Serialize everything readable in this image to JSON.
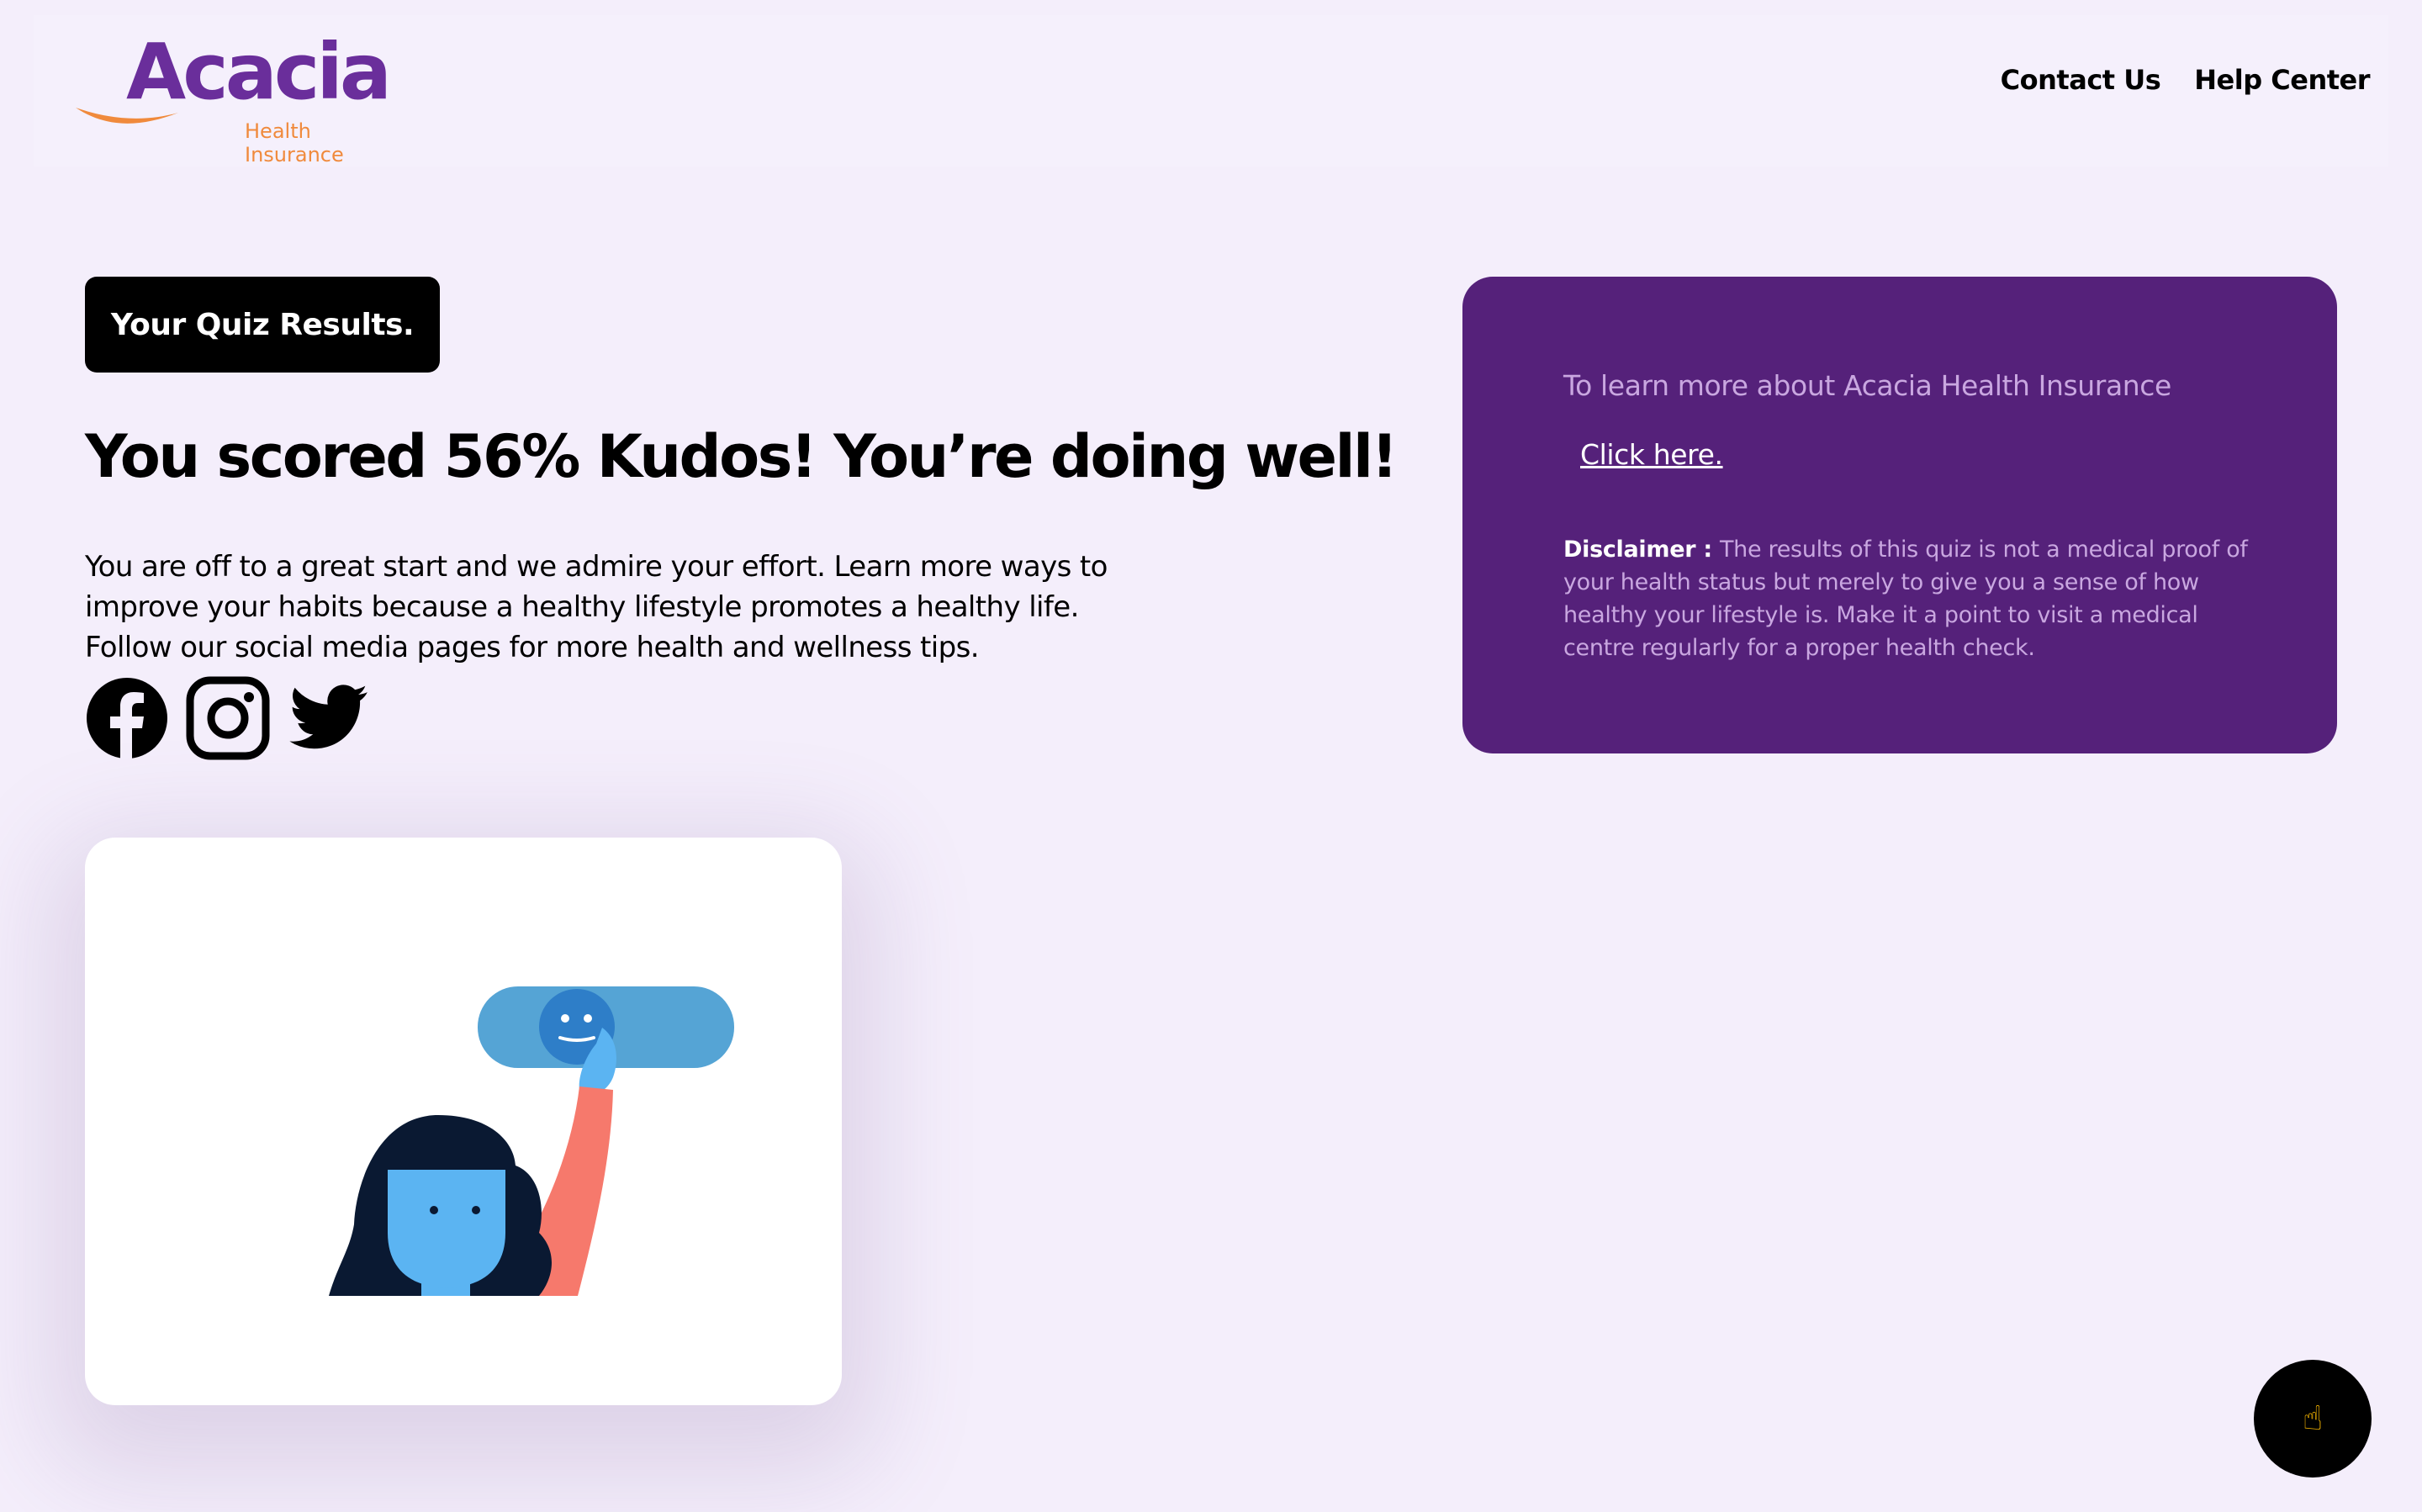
{
  "header": {
    "logo_text": "Acacia",
    "logo_tagline": "Health Insurance",
    "nav": [
      {
        "label": "Contact Us"
      },
      {
        "label": "Help Center"
      }
    ]
  },
  "results": {
    "badge": "Your Quiz Results.",
    "title": "You scored 56% Kudos! You’re doing well!",
    "body": "You are off to a great start and we admire your effort. Learn more ways to improve your habits because a healthy lifestyle promotes a healthy life. Follow our social media pages for more health and wellness tips."
  },
  "social": [
    {
      "icon": "facebook-icon"
    },
    {
      "icon": "instagram-icon"
    },
    {
      "icon": "twitter-icon"
    }
  ],
  "info": {
    "lead": "To learn more about Acacia Health Insurance",
    "link": "Click here.",
    "disclaimer_label": "Disclaimer : ",
    "disclaimer_text": "The results of this quiz is not a medical proof of your health status but merely to give you a sense of how healthy your lifestyle is. Make it a point to visit a medical centre regularly for a proper health check."
  },
  "fab": {
    "icon": "pointing-hand-icon",
    "glyph": "☝"
  },
  "colors": {
    "background": "#f4eefb",
    "panel": "#55217a",
    "brand_purple": "#6a2e9b",
    "brand_orange": "#f08a3c"
  }
}
